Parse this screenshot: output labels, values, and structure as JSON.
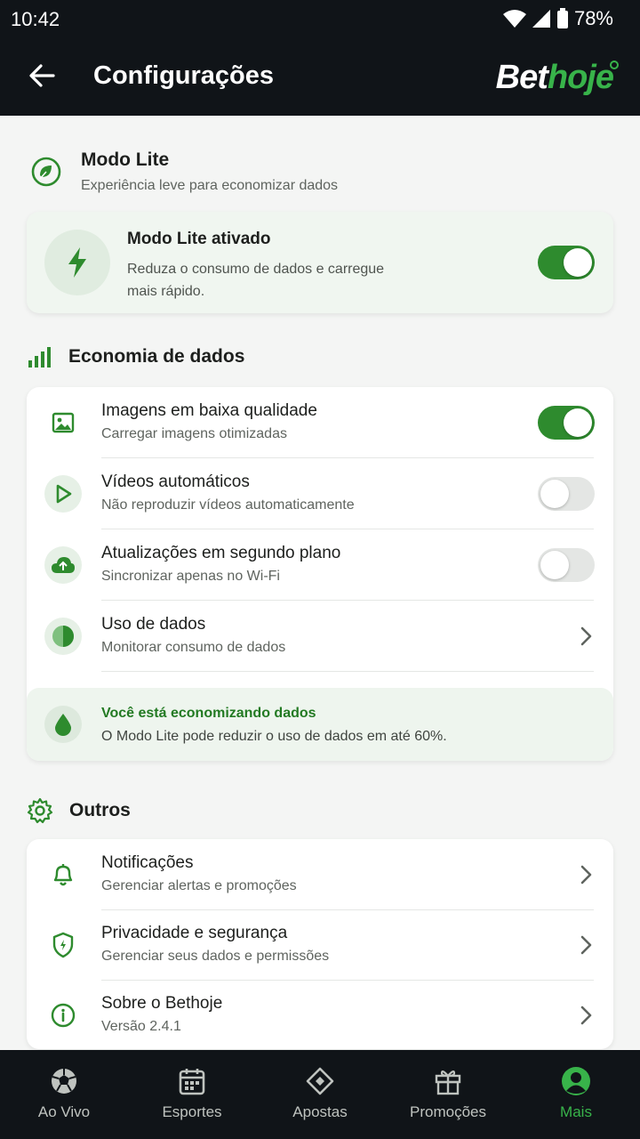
{
  "status_bar": {
    "time": "10:42",
    "battery": "78%"
  },
  "app_bar": {
    "title": "Configurações",
    "logo_part1": "Bet",
    "logo_part2": "hoje"
  },
  "lite_section": {
    "title": "Modo Lite",
    "subtitle": "Experiência leve para economizar dados",
    "card_title": "Modo Lite ativado",
    "card_desc_line1": "Reduza o consumo de dados e carregue",
    "card_desc_line2": "mais rápido.",
    "toggle_on": true
  },
  "data_section": {
    "title": "Economia de dados",
    "items": [
      {
        "label": "Imagens em baixa qualidade",
        "desc": "Carregar imagens otimizadas",
        "control": "toggle",
        "on": true,
        "icon": "image-icon"
      },
      {
        "label": "Vídeos automáticos",
        "desc": "Não reproduzir vídeos automaticamente",
        "control": "toggle",
        "on": false,
        "icon": "play-icon"
      },
      {
        "label": "Atualizações em segundo plano",
        "desc": "Sincronizar apenas no Wi-Fi",
        "control": "toggle",
        "on": false,
        "icon": "cloud-upload-icon"
      },
      {
        "label": "Uso de dados",
        "desc": "Monitorar consumo de dados",
        "control": "chevron",
        "icon": "pie-chart-icon"
      }
    ],
    "banner_title": "Você está economizando dados",
    "banner_text": "O Modo Lite pode reduzir o uso de dados em até 60%."
  },
  "other_section": {
    "title": "Outros",
    "items": [
      {
        "label": "Notificações",
        "desc": "Gerenciar alertas e promoções",
        "icon": "bell-icon"
      },
      {
        "label": "Privacidade e segurança",
        "desc": "Gerenciar seus dados e permissões",
        "icon": "shield-icon"
      },
      {
        "label": "Sobre o Bethoje",
        "desc": "Versão 2.4.1",
        "icon": "info-icon"
      }
    ]
  },
  "bottom_nav": {
    "tabs": [
      {
        "label": "Ao Vivo",
        "icon": "soccer-ball-icon"
      },
      {
        "label": "Esportes",
        "icon": "calendar-icon"
      },
      {
        "label": "Apostas",
        "icon": "ticket-icon"
      },
      {
        "label": "Promoções",
        "icon": "gift-icon"
      },
      {
        "label": "Mais",
        "icon": "user-icon",
        "active": true
      }
    ]
  },
  "colors": {
    "accent": "#2e8b2e",
    "brand_green": "#38b34a",
    "dark_bar": "#101418"
  }
}
